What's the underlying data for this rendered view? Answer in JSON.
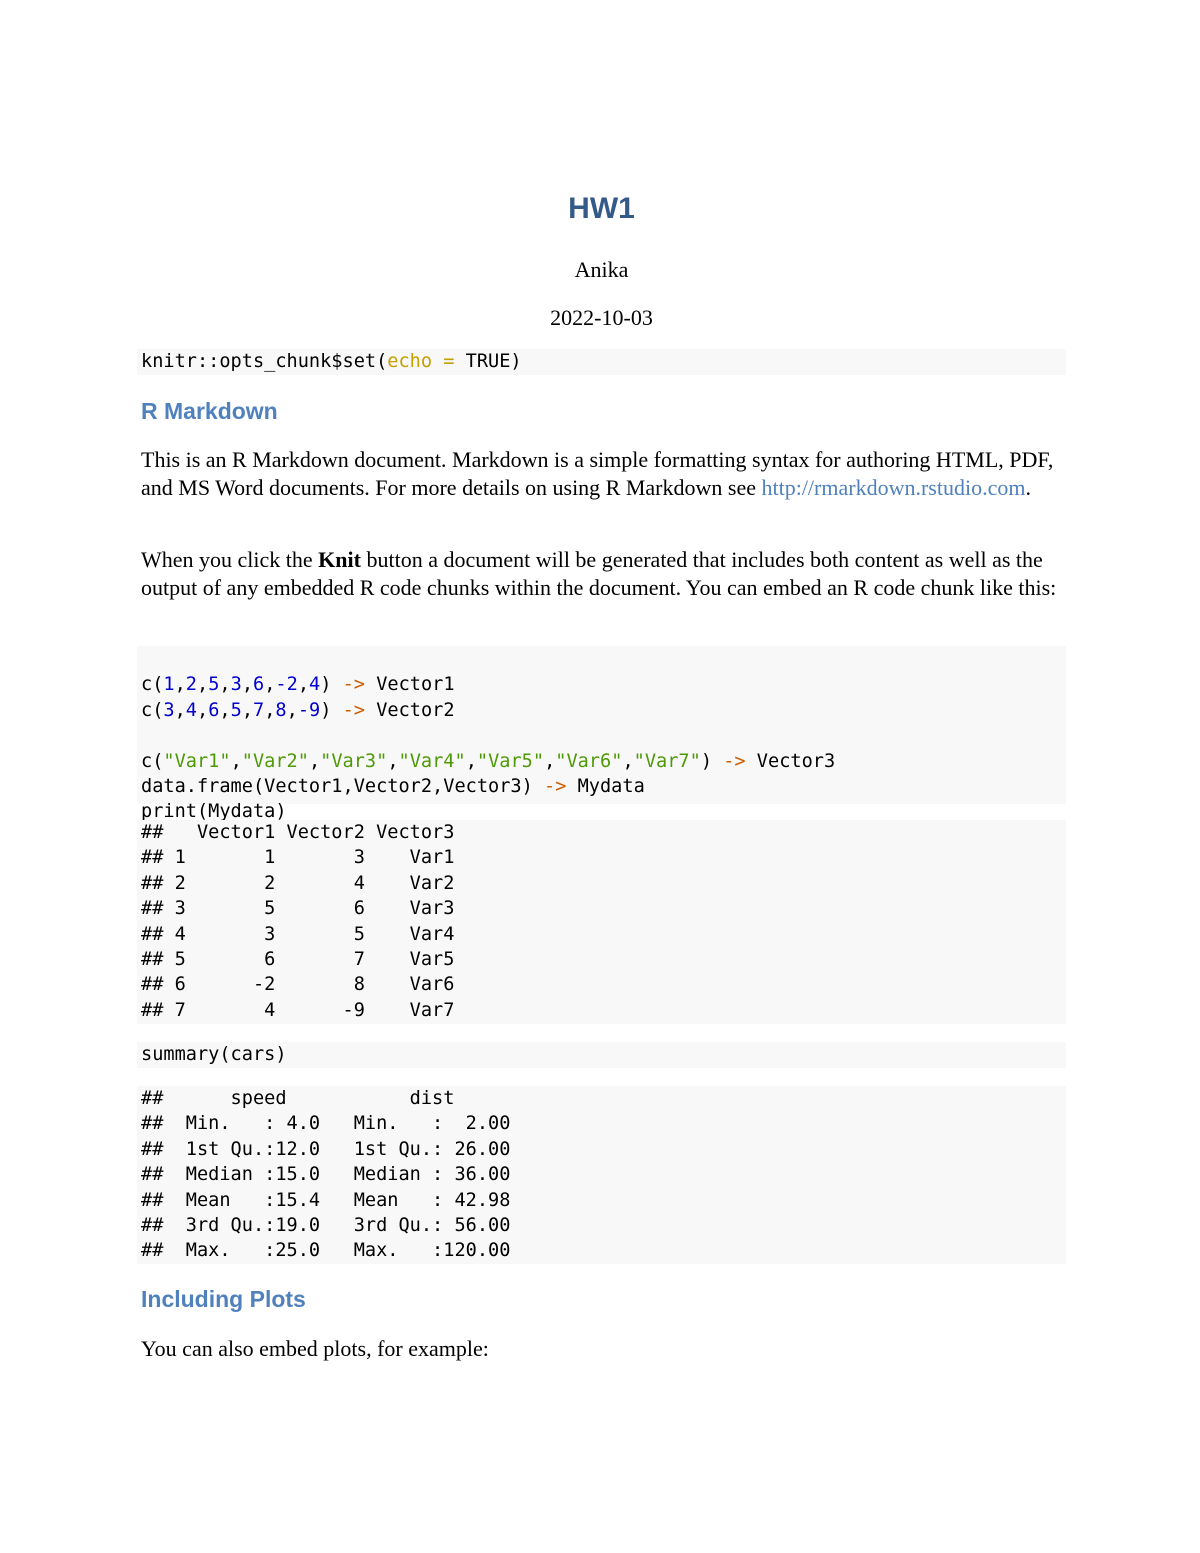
{
  "document": {
    "title": "HW1",
    "author": "Anika",
    "date": "2022-10-03"
  },
  "setup_chunk": {
    "prefix": "knitr::opts_chunk$set(",
    "arg": "echo",
    "eq": " = ",
    "value": "TRUE)"
  },
  "section1": {
    "heading": "R Markdown",
    "para1_text": "This is an R Markdown document. Markdown is a simple formatting syntax for authoring HTML, PDF, and MS Word documents. For more details on using R Markdown see ",
    "para1_link": "http://rmarkdown.rstudio.com",
    "para1_end": ".",
    "para2_before": "When you click the ",
    "para2_bold": "Knit",
    "para2_after": " button a document will be generated that includes both content as well as the output of any embedded R code chunks within the document. You can embed an R code chunk like this:"
  },
  "code_chunk1": {
    "line1": {
      "open": "c(",
      "nums": [
        "1",
        "2",
        "5",
        "3",
        "6",
        "-2",
        "4"
      ],
      "close": ")",
      "arrow": " ->",
      "target": " Vector1"
    },
    "line2": {
      "open": "c(",
      "nums": [
        "3",
        "4",
        "6",
        "5",
        "7",
        "8",
        "-9"
      ],
      "close": ")",
      "arrow": " ->",
      "target": " Vector2"
    },
    "line3": {
      "open": "c(",
      "strs": [
        "\"Var1\"",
        "\"Var2\"",
        "\"Var3\"",
        "\"Var4\"",
        "\"Var5\"",
        "\"Var6\"",
        "\"Var7\""
      ],
      "close": ")",
      "arrow": " ->",
      "target": " Vector3"
    },
    "line4": {
      "pre": "data.frame(Vector1,Vector2,Vector3)",
      "arrow": " ->",
      "target": " Mydata"
    },
    "line5": "print(Mydata)"
  },
  "output1": {
    "lines": [
      "##   Vector1 Vector2 Vector3",
      "## 1       1       3    Var1",
      "## 2       2       4    Var2",
      "## 3       5       6    Var3",
      "## 4       3       5    Var4",
      "## 5       6       7    Var5",
      "## 6      -2       8    Var6",
      "## 7       4      -9    Var7"
    ]
  },
  "code_chunk2": {
    "line": "summary(cars)"
  },
  "output2": {
    "lines": [
      "##      speed           dist       ",
      "##  Min.   : 4.0   Min.   :  2.00  ",
      "##  1st Qu.:12.0   1st Qu.: 26.00  ",
      "##  Median :15.0   Median : 36.00  ",
      "##  Mean   :15.4   Mean   : 42.98  ",
      "##  3rd Qu.:19.0   3rd Qu.: 56.00  ",
      "##  Max.   :25.0   Max.   :120.00  "
    ]
  },
  "section2": {
    "heading": "Including Plots",
    "para": "You can also embed plots, for example:"
  }
}
